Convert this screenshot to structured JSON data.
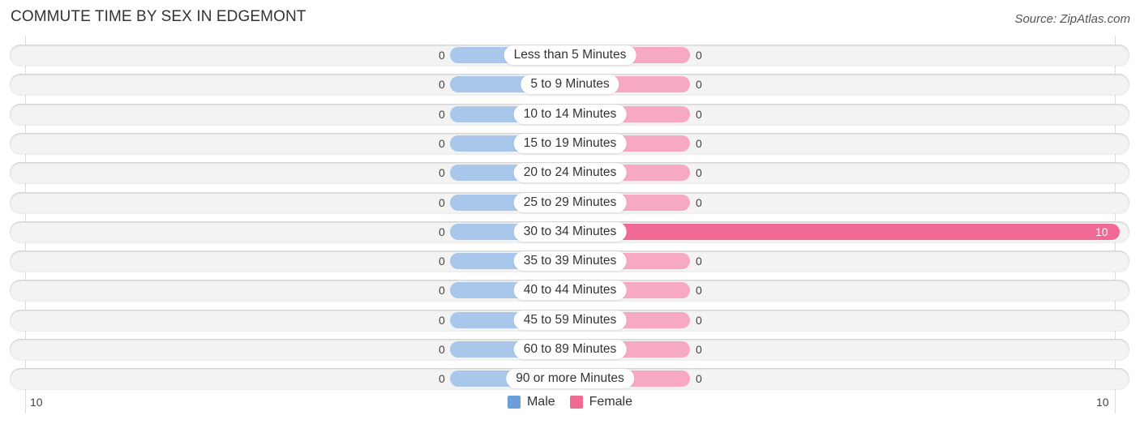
{
  "title": "COMMUTE TIME BY SEX IN EDGEMONT",
  "source": "Source: ZipAtlas.com",
  "colors": {
    "male": "#a8c7ea",
    "female_light": "#f7a8c3",
    "female_full": "#f06a95",
    "male_legend": "#6a9fdc",
    "female_legend": "#f06a95"
  },
  "chart_data": {
    "type": "bar",
    "orientation": "horizontal-diverging",
    "title": "COMMUTE TIME BY SEX IN EDGEMONT",
    "categories": [
      "Less than 5 Minutes",
      "5 to 9 Minutes",
      "10 to 14 Minutes",
      "15 to 19 Minutes",
      "20 to 24 Minutes",
      "25 to 29 Minutes",
      "30 to 34 Minutes",
      "35 to 39 Minutes",
      "40 to 44 Minutes",
      "45 to 59 Minutes",
      "60 to 89 Minutes",
      "90 or more Minutes"
    ],
    "series": [
      {
        "name": "Male",
        "values": [
          0,
          0,
          0,
          0,
          0,
          0,
          0,
          0,
          0,
          0,
          0,
          0
        ]
      },
      {
        "name": "Female",
        "values": [
          0,
          0,
          0,
          0,
          0,
          0,
          10,
          0,
          0,
          0,
          0,
          0
        ]
      }
    ],
    "axis_ticks": {
      "left": "10",
      "right": "10"
    },
    "xlim": [
      -10,
      10
    ],
    "legend": [
      "Male",
      "Female"
    ],
    "legend_position": "bottom-center"
  }
}
